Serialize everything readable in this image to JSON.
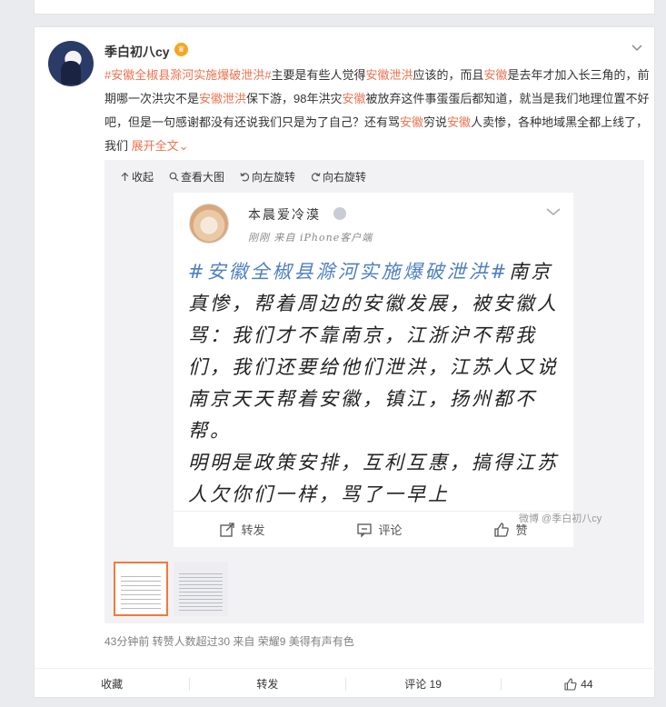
{
  "post": {
    "username": "季白初八cy",
    "text_parts": {
      "tag": "#安徽全椒县滁河实施爆破泄洪#",
      "p1": "主要是有些人觉得",
      "k1": "安徽泄洪",
      "p2": "应该的，而且",
      "k2": "安徽",
      "p3": "是去年才加入长三角的，前期哪一次洪灾不是",
      "k3": "安徽泄洪",
      "p4": "保下游，98年洪灾",
      "k4": "安徽",
      "p5": "被放弃这件事蛋蛋后都知道，就当是我们地理位置不好吧，但是一句感谢都没有还说我们只是为了自己？还有骂",
      "k5": "安徽",
      "p6": "穷说",
      "k6": "安徽",
      "p7": "人卖惨，各种地域黑全都上线了，我们",
      "expand": "展开全文"
    },
    "meta": "43分钟前 转赞人数超过30 来自 荣耀9 美得有声有色"
  },
  "media_toolbar": {
    "collapse": "收起",
    "view_large": "查看大图",
    "rotate_left": "向左旋转",
    "rotate_right": "向右旋转"
  },
  "photo": {
    "inner_name": "本晨爱冷漠",
    "inner_source": "刚刚 来自 iPhone客户端",
    "hand_tag": "#安徽全椒县滁河实施爆破泄洪#",
    "hand_text": "南京真惨，帮着周边的安徽发展，被安徽人骂：我们才不靠南京，江浙沪不帮我们，我们还要给他们泄洪，江苏人又说南京天天帮着安徽，镇江，扬州都不帮。",
    "hand_text2": "明明是政策安排，互利互惠，搞得江苏人欠你们一样，骂了一早上",
    "repost": "转发",
    "comment": "评论",
    "like": "赞",
    "watermark": "微博 @季白初八cy"
  },
  "actions": {
    "collect": "收藏",
    "forward": "转发",
    "comment": "评论 19",
    "like": "44"
  },
  "colors": {
    "accent": "#eb7350",
    "hand_tag": "#4f7fc2",
    "thumb_active_border": "#f07a3a"
  }
}
